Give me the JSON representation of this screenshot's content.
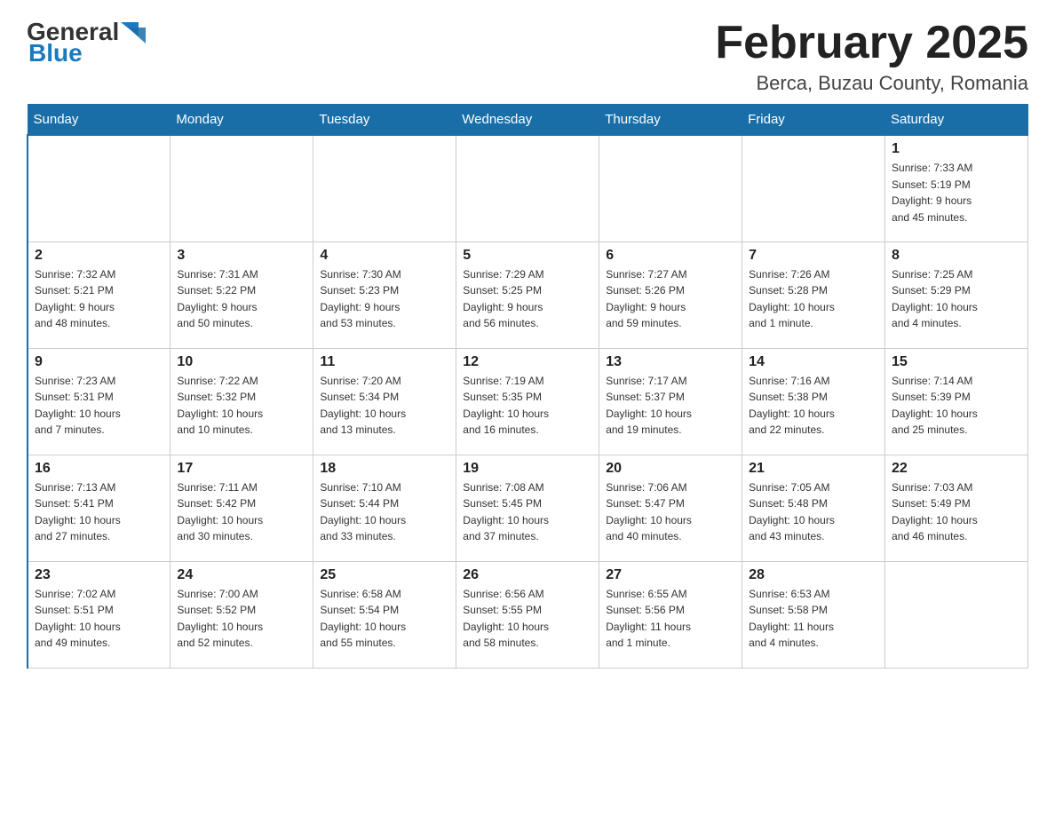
{
  "header": {
    "logo_general": "General",
    "logo_blue": "Blue",
    "title": "February 2025",
    "subtitle": "Berca, Buzau County, Romania"
  },
  "weekdays": [
    "Sunday",
    "Monday",
    "Tuesday",
    "Wednesday",
    "Thursday",
    "Friday",
    "Saturday"
  ],
  "rows": [
    [
      {
        "day": "",
        "info": ""
      },
      {
        "day": "",
        "info": ""
      },
      {
        "day": "",
        "info": ""
      },
      {
        "day": "",
        "info": ""
      },
      {
        "day": "",
        "info": ""
      },
      {
        "day": "",
        "info": ""
      },
      {
        "day": "1",
        "info": "Sunrise: 7:33 AM\nSunset: 5:19 PM\nDaylight: 9 hours\nand 45 minutes."
      }
    ],
    [
      {
        "day": "2",
        "info": "Sunrise: 7:32 AM\nSunset: 5:21 PM\nDaylight: 9 hours\nand 48 minutes."
      },
      {
        "day": "3",
        "info": "Sunrise: 7:31 AM\nSunset: 5:22 PM\nDaylight: 9 hours\nand 50 minutes."
      },
      {
        "day": "4",
        "info": "Sunrise: 7:30 AM\nSunset: 5:23 PM\nDaylight: 9 hours\nand 53 minutes."
      },
      {
        "day": "5",
        "info": "Sunrise: 7:29 AM\nSunset: 5:25 PM\nDaylight: 9 hours\nand 56 minutes."
      },
      {
        "day": "6",
        "info": "Sunrise: 7:27 AM\nSunset: 5:26 PM\nDaylight: 9 hours\nand 59 minutes."
      },
      {
        "day": "7",
        "info": "Sunrise: 7:26 AM\nSunset: 5:28 PM\nDaylight: 10 hours\nand 1 minute."
      },
      {
        "day": "8",
        "info": "Sunrise: 7:25 AM\nSunset: 5:29 PM\nDaylight: 10 hours\nand 4 minutes."
      }
    ],
    [
      {
        "day": "9",
        "info": "Sunrise: 7:23 AM\nSunset: 5:31 PM\nDaylight: 10 hours\nand 7 minutes."
      },
      {
        "day": "10",
        "info": "Sunrise: 7:22 AM\nSunset: 5:32 PM\nDaylight: 10 hours\nand 10 minutes."
      },
      {
        "day": "11",
        "info": "Sunrise: 7:20 AM\nSunset: 5:34 PM\nDaylight: 10 hours\nand 13 minutes."
      },
      {
        "day": "12",
        "info": "Sunrise: 7:19 AM\nSunset: 5:35 PM\nDaylight: 10 hours\nand 16 minutes."
      },
      {
        "day": "13",
        "info": "Sunrise: 7:17 AM\nSunset: 5:37 PM\nDaylight: 10 hours\nand 19 minutes."
      },
      {
        "day": "14",
        "info": "Sunrise: 7:16 AM\nSunset: 5:38 PM\nDaylight: 10 hours\nand 22 minutes."
      },
      {
        "day": "15",
        "info": "Sunrise: 7:14 AM\nSunset: 5:39 PM\nDaylight: 10 hours\nand 25 minutes."
      }
    ],
    [
      {
        "day": "16",
        "info": "Sunrise: 7:13 AM\nSunset: 5:41 PM\nDaylight: 10 hours\nand 27 minutes."
      },
      {
        "day": "17",
        "info": "Sunrise: 7:11 AM\nSunset: 5:42 PM\nDaylight: 10 hours\nand 30 minutes."
      },
      {
        "day": "18",
        "info": "Sunrise: 7:10 AM\nSunset: 5:44 PM\nDaylight: 10 hours\nand 33 minutes."
      },
      {
        "day": "19",
        "info": "Sunrise: 7:08 AM\nSunset: 5:45 PM\nDaylight: 10 hours\nand 37 minutes."
      },
      {
        "day": "20",
        "info": "Sunrise: 7:06 AM\nSunset: 5:47 PM\nDaylight: 10 hours\nand 40 minutes."
      },
      {
        "day": "21",
        "info": "Sunrise: 7:05 AM\nSunset: 5:48 PM\nDaylight: 10 hours\nand 43 minutes."
      },
      {
        "day": "22",
        "info": "Sunrise: 7:03 AM\nSunset: 5:49 PM\nDaylight: 10 hours\nand 46 minutes."
      }
    ],
    [
      {
        "day": "23",
        "info": "Sunrise: 7:02 AM\nSunset: 5:51 PM\nDaylight: 10 hours\nand 49 minutes."
      },
      {
        "day": "24",
        "info": "Sunrise: 7:00 AM\nSunset: 5:52 PM\nDaylight: 10 hours\nand 52 minutes."
      },
      {
        "day": "25",
        "info": "Sunrise: 6:58 AM\nSunset: 5:54 PM\nDaylight: 10 hours\nand 55 minutes."
      },
      {
        "day": "26",
        "info": "Sunrise: 6:56 AM\nSunset: 5:55 PM\nDaylight: 10 hours\nand 58 minutes."
      },
      {
        "day": "27",
        "info": "Sunrise: 6:55 AM\nSunset: 5:56 PM\nDaylight: 11 hours\nand 1 minute."
      },
      {
        "day": "28",
        "info": "Sunrise: 6:53 AM\nSunset: 5:58 PM\nDaylight: 11 hours\nand 4 minutes."
      },
      {
        "day": "",
        "info": ""
      }
    ]
  ]
}
